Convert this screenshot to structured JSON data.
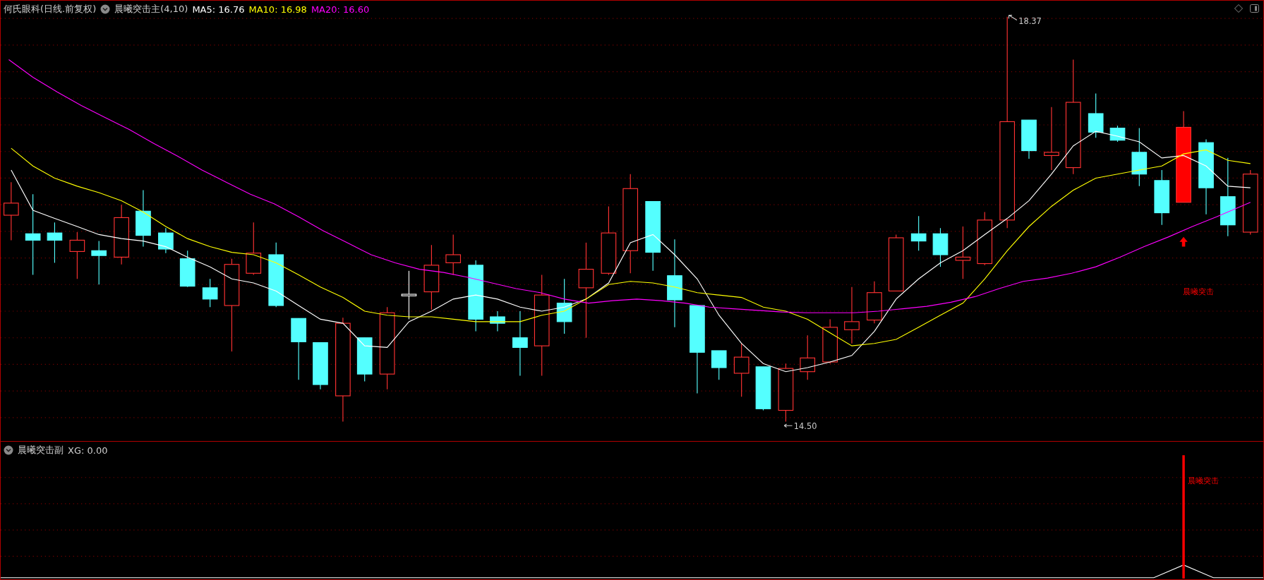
{
  "header": {
    "stock": "何氏眼科(日线.前复权)",
    "indicator": "晨曦突击主(4,10)",
    "ma": [
      {
        "label": "MA5: 16.76",
        "color": "#ffffff"
      },
      {
        "label": "MA10: 16.98",
        "color": "#ffff00"
      },
      {
        "label": "MA20: 16.60",
        "color": "#ff00ff"
      }
    ]
  },
  "main_chart": {
    "high_label": "18.37",
    "low_label": "14.50",
    "signal_label": "晨曦突击"
  },
  "sub_panel": {
    "indicator": "晨曦突击副",
    "reading": "XG: 0.00",
    "signal_label": "晨曦突击"
  }
}
